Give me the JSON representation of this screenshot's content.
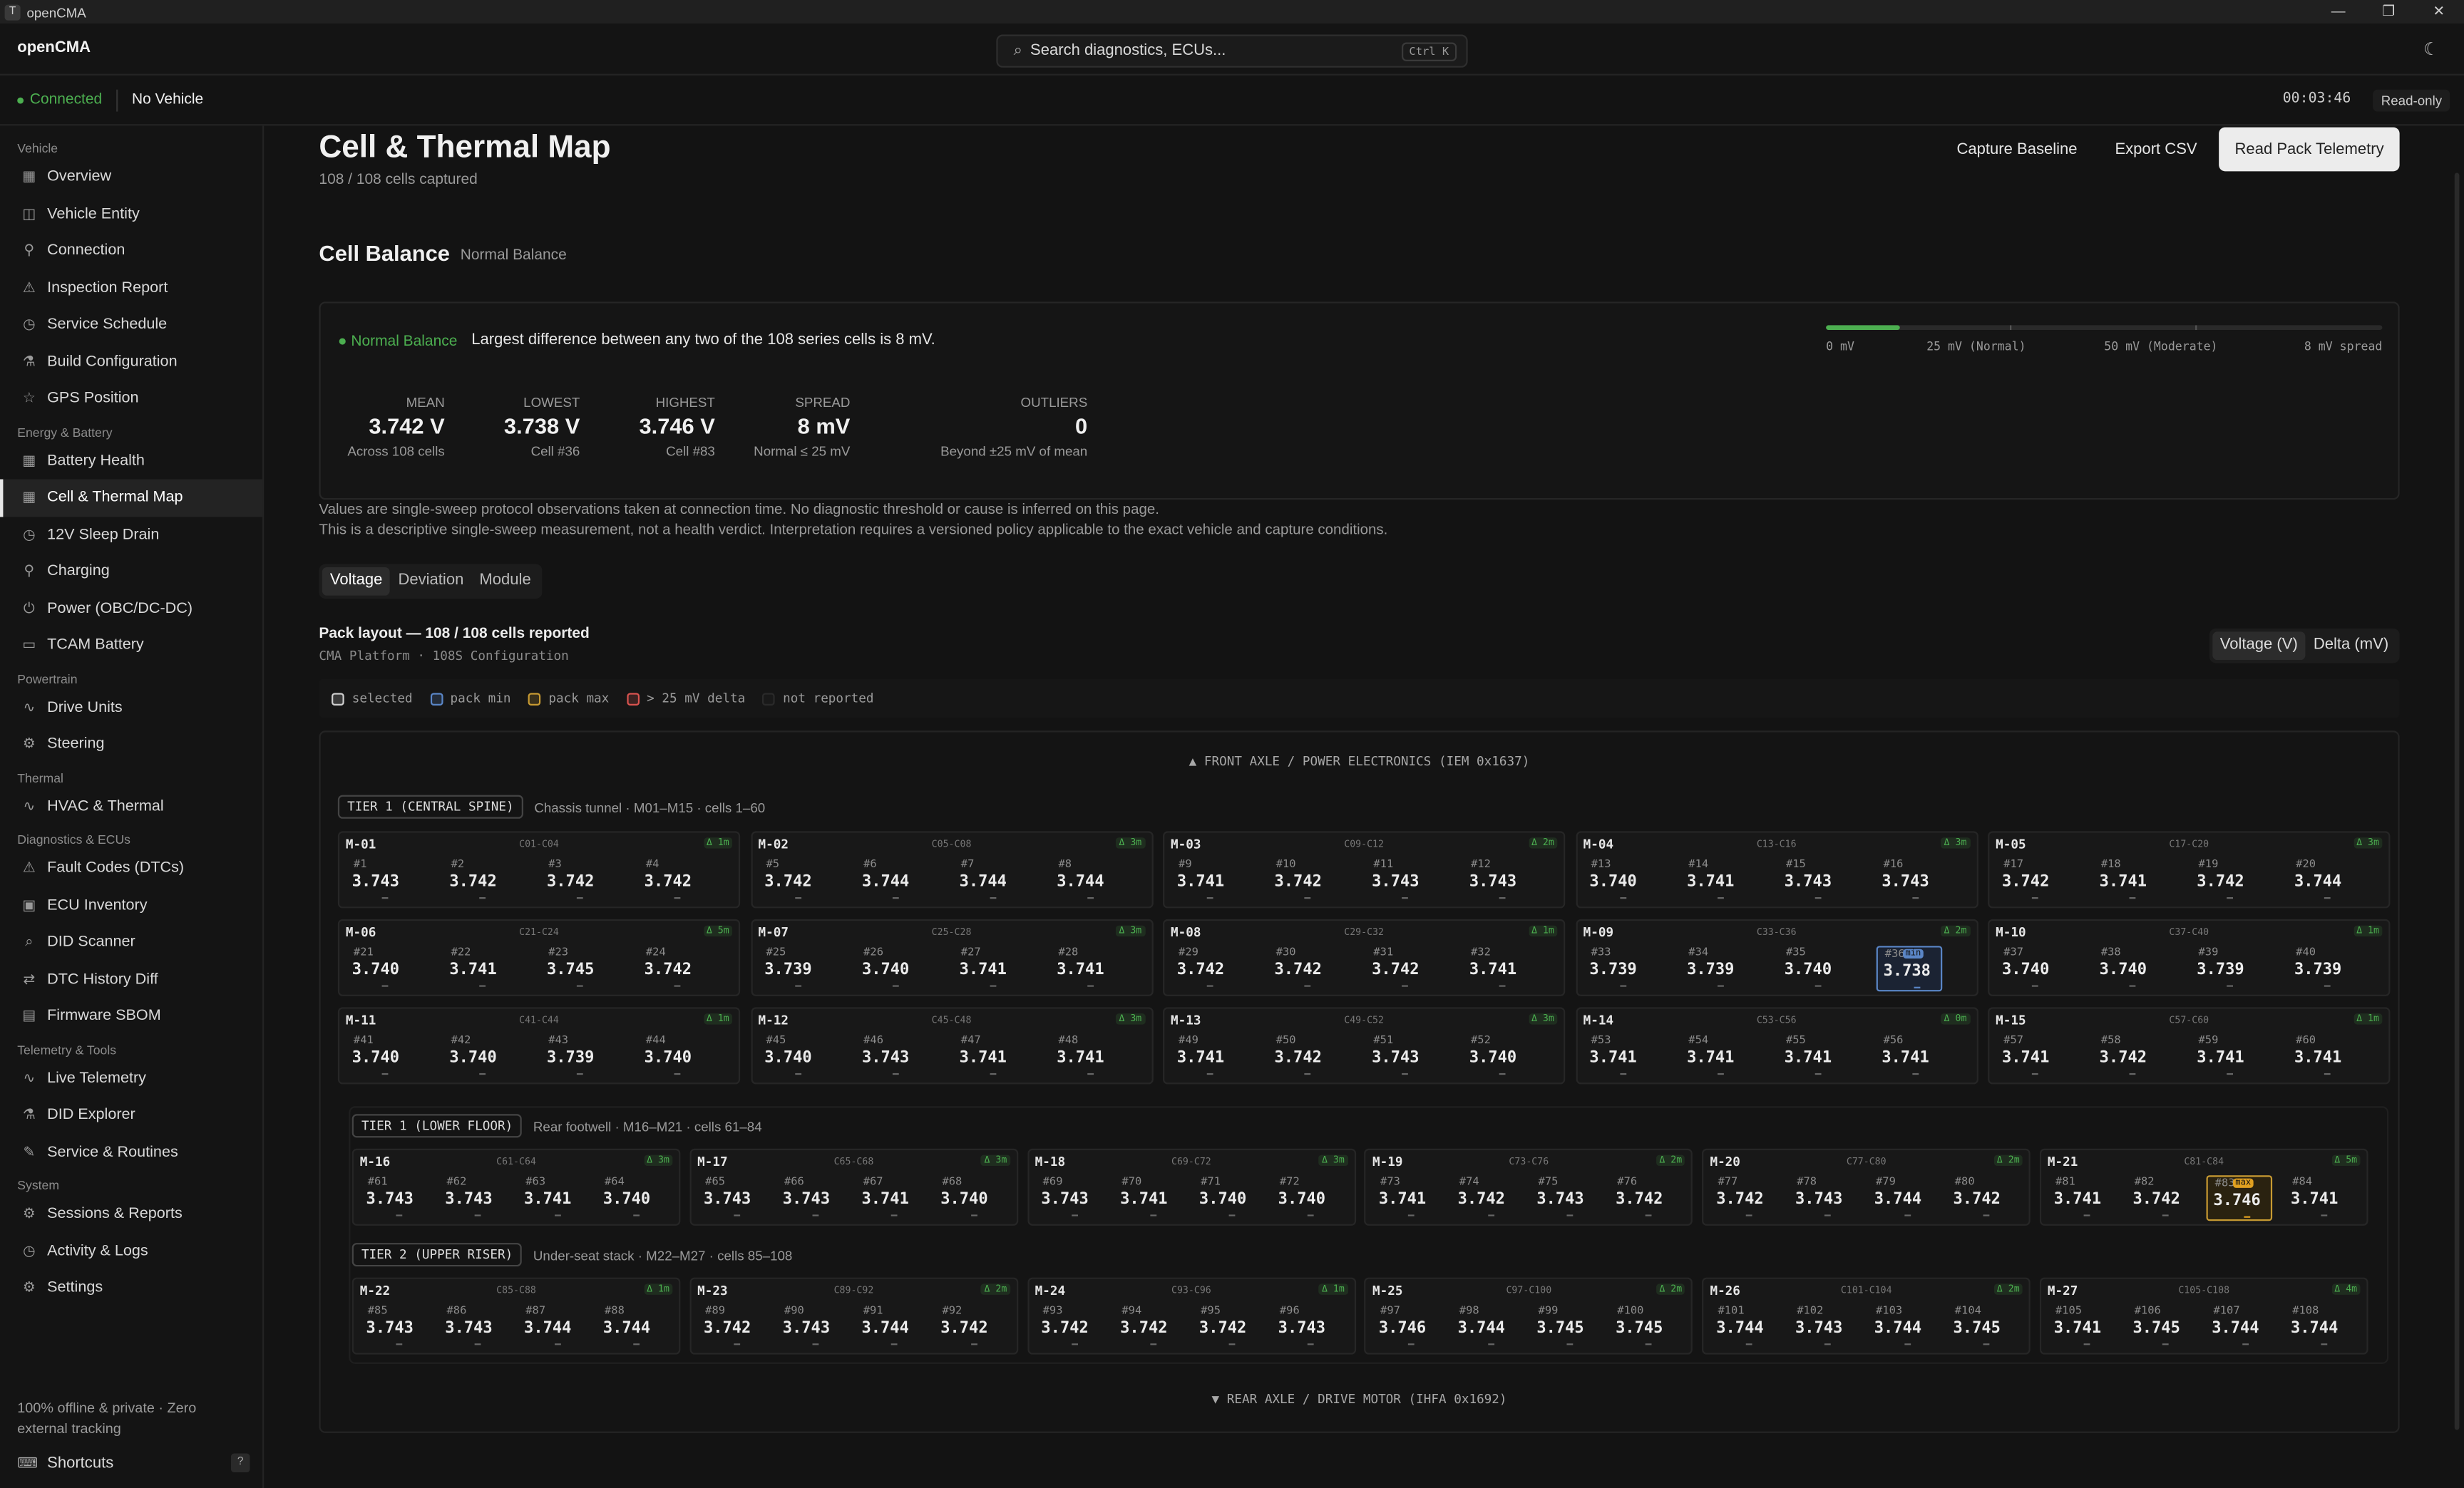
{
  "window": {
    "title": "openCMA",
    "logo": "T",
    "controls": [
      "—",
      "❐",
      "✕"
    ]
  },
  "brand": "openCMA",
  "search": {
    "placeholder": "Search diagnostics, ECUs...",
    "shortcut": "Ctrl K"
  },
  "status": {
    "connection": "Connected",
    "vehicle": "No Vehicle",
    "timer": "00:03:46",
    "mode": "Read-only"
  },
  "sidebar": {
    "sections": [
      {
        "title": "Vehicle",
        "items": [
          {
            "label": "Overview",
            "icon": "grid-icon"
          },
          {
            "label": "Vehicle Entity",
            "icon": "database-icon"
          },
          {
            "label": "Connection",
            "icon": "plug-icon"
          },
          {
            "label": "Inspection Report",
            "icon": "warning-icon"
          },
          {
            "label": "Service Schedule",
            "icon": "clock-icon"
          },
          {
            "label": "Build Configuration",
            "icon": "flask-icon"
          },
          {
            "label": "GPS Position",
            "icon": "star-icon"
          }
        ]
      },
      {
        "title": "Energy & Battery",
        "items": [
          {
            "label": "Battery Health",
            "icon": "grid-icon"
          },
          {
            "label": "Cell & Thermal Map",
            "icon": "grid-icon",
            "active": true
          },
          {
            "label": "12V Sleep Drain",
            "icon": "clock-icon"
          },
          {
            "label": "Charging",
            "icon": "plug-icon"
          },
          {
            "label": "Power (OBC/DC-DC)",
            "icon": "power-icon"
          },
          {
            "label": "TCAM Battery",
            "icon": "battery-icon"
          }
        ]
      },
      {
        "title": "Powertrain",
        "items": [
          {
            "label": "Drive Units",
            "icon": "pulse-icon"
          },
          {
            "label": "Steering",
            "icon": "gear-icon"
          }
        ]
      },
      {
        "title": "Thermal",
        "items": [
          {
            "label": "HVAC & Thermal",
            "icon": "pulse-icon"
          }
        ]
      },
      {
        "title": "Diagnostics & ECUs",
        "items": [
          {
            "label": "Fault Codes (DTCs)",
            "icon": "warning-icon"
          },
          {
            "label": "ECU Inventory",
            "icon": "cpu-icon"
          },
          {
            "label": "DID Scanner",
            "icon": "search-icon"
          },
          {
            "label": "DTC History Diff",
            "icon": "diff-icon"
          },
          {
            "label": "Firmware SBOM",
            "icon": "package-icon"
          }
        ]
      },
      {
        "title": "Telemetry & Tools",
        "items": [
          {
            "label": "Live Telemetry",
            "icon": "pulse-icon"
          },
          {
            "label": "DID Explorer",
            "icon": "flask-icon"
          },
          {
            "label": "Service & Routines",
            "icon": "wrench-icon"
          }
        ]
      },
      {
        "title": "System",
        "items": [
          {
            "label": "Sessions & Reports",
            "icon": "gear-icon"
          },
          {
            "label": "Activity & Logs",
            "icon": "clock-icon"
          },
          {
            "label": "Settings",
            "icon": "gear-icon"
          }
        ]
      }
    ],
    "footer": "100% offline & private · Zero external tracking",
    "shortcuts": "Shortcuts",
    "shortcuts_key": "?"
  },
  "page": {
    "title": "Cell & Thermal Map",
    "subtitle": "108 / 108 cells captured",
    "buttons": {
      "capture": "Capture Baseline",
      "export": "Export CSV",
      "read": "Read Pack Telemetry"
    }
  },
  "balance": {
    "title": "Cell Balance",
    "subtitle": "Normal Balance",
    "status": "Normal Balance",
    "message": "Largest difference between any two of the 108 series cells is 8 mV.",
    "spread_mv": 8,
    "scale_max_mv": 60,
    "scale_labels": [
      "0 mV",
      "25 mV (Normal)",
      "50 mV (Moderate)",
      "8 mV spread"
    ],
    "stats": [
      {
        "label": "MEAN",
        "value": "3.742 V",
        "note": "Across 108 cells"
      },
      {
        "label": "LOWEST",
        "value": "3.738 V",
        "note": "Cell #36"
      },
      {
        "label": "HIGHEST",
        "value": "3.746 V",
        "note": "Cell #83"
      },
      {
        "label": "SPREAD",
        "value": "8 mV",
        "note": "Normal ≤ 25 mV"
      },
      {
        "label": "OUTLIERS",
        "value": "0",
        "note": "Beyond ±25 mV of mean"
      }
    ],
    "notes": [
      "Values are single-sweep protocol observations taken at connection time. No diagnostic threshold or cause is inferred on this page.",
      "This is a descriptive single-sweep measurement, not a health verdict. Interpretation requires a versioned policy applicable to the exact vehicle and capture conditions."
    ]
  },
  "tabs": [
    "Voltage",
    "Deviation",
    "Module"
  ],
  "layout": {
    "title": "Pack layout — 108 / 108 cells reported",
    "subtitle": "CMA Platform · 108S Configuration",
    "toggle": [
      "Voltage (V)",
      "Delta (mV)"
    ],
    "legend": [
      {
        "label": "selected",
        "color": "#cfcfcf"
      },
      {
        "label": "pack min",
        "color": "#5a86c7"
      },
      {
        "label": "pack max",
        "color": "#c79a32"
      },
      {
        "label": "> 25 mV delta",
        "color": "#d9534f"
      },
      {
        "label": "not reported",
        "color": "#2a2a2a"
      }
    ],
    "front": "▲ FRONT AXLE / POWER ELECTRONICS (IEM 0x1637)",
    "rear": "▼ REAR AXLE / DRIVE MOTOR (IHFA 0x1692)",
    "tiers": [
      {
        "badge": "TIER 1 (CENTRAL SPINE)",
        "desc": "Chassis tunnel · M01–M15 · cells 1–60"
      },
      {
        "badge": "TIER 1 (LOWER FLOOR)",
        "desc": "Rear footwell · M16–M21 · cells 61–84"
      },
      {
        "badge": "TIER 2 (UPPER RISER)",
        "desc": "Under-seat stack · M22–M27 · cells 85–108"
      }
    ],
    "modules": [
      {
        "id": "M-01",
        "range": "C01-C04",
        "age": "Δ 1m",
        "cells": [
          3.743,
          3.742,
          3.742,
          3.742
        ]
      },
      {
        "id": "M-02",
        "range": "C05-C08",
        "age": "Δ 3m",
        "cells": [
          3.742,
          3.744,
          3.744,
          3.744
        ]
      },
      {
        "id": "M-03",
        "range": "C09-C12",
        "age": "Δ 2m",
        "cells": [
          3.741,
          3.742,
          3.743,
          3.743
        ]
      },
      {
        "id": "M-04",
        "range": "C13-C16",
        "age": "Δ 3m",
        "cells": [
          3.74,
          3.741,
          3.743,
          3.743
        ]
      },
      {
        "id": "M-05",
        "range": "C17-C20",
        "age": "Δ 3m",
        "cells": [
          3.742,
          3.741,
          3.742,
          3.744
        ]
      },
      {
        "id": "M-06",
        "range": "C21-C24",
        "age": "Δ 5m",
        "cells": [
          3.74,
          3.741,
          3.745,
          3.742
        ]
      },
      {
        "id": "M-07",
        "range": "C25-C28",
        "age": "Δ 3m",
        "cells": [
          3.739,
          3.74,
          3.741,
          3.741
        ]
      },
      {
        "id": "M-08",
        "range": "C29-C32",
        "age": "Δ 1m",
        "cells": [
          3.742,
          3.742,
          3.742,
          3.741
        ]
      },
      {
        "id": "M-09",
        "range": "C33-C36",
        "age": "Δ 2m",
        "cells": [
          3.739,
          3.739,
          3.74,
          3.738
        ]
      },
      {
        "id": "M-10",
        "range": "C37-C40",
        "age": "Δ 1m",
        "cells": [
          3.74,
          3.74,
          3.739,
          3.739
        ]
      },
      {
        "id": "M-11",
        "range": "C41-C44",
        "age": "Δ 1m",
        "cells": [
          3.74,
          3.74,
          3.739,
          3.74
        ]
      },
      {
        "id": "M-12",
        "range": "C45-C48",
        "age": "Δ 3m",
        "cells": [
          3.74,
          3.743,
          3.741,
          3.741
        ]
      },
      {
        "id": "M-13",
        "range": "C49-C52",
        "age": "Δ 3m",
        "cells": [
          3.741,
          3.742,
          3.743,
          3.74
        ]
      },
      {
        "id": "M-14",
        "range": "C53-C56",
        "age": "Δ 0m",
        "cells": [
          3.741,
          3.741,
          3.741,
          3.741
        ]
      },
      {
        "id": "M-15",
        "range": "C57-C60",
        "age": "Δ 1m",
        "cells": [
          3.741,
          3.742,
          3.741,
          3.741
        ]
      },
      {
        "id": "M-16",
        "range": "C61-C64",
        "age": "Δ 3m",
        "cells": [
          3.743,
          3.743,
          3.741,
          3.74
        ]
      },
      {
        "id": "M-17",
        "range": "C65-C68",
        "age": "Δ 3m",
        "cells": [
          3.743,
          3.743,
          3.741,
          3.74
        ]
      },
      {
        "id": "M-18",
        "range": "C69-C72",
        "age": "Δ 3m",
        "cells": [
          3.743,
          3.741,
          3.74,
          3.74
        ]
      },
      {
        "id": "M-19",
        "range": "C73-C76",
        "age": "Δ 2m",
        "cells": [
          3.741,
          3.742,
          3.743,
          3.742
        ]
      },
      {
        "id": "M-20",
        "range": "C77-C80",
        "age": "Δ 2m",
        "cells": [
          3.742,
          3.743,
          3.744,
          3.742
        ]
      },
      {
        "id": "M-21",
        "range": "C81-C84",
        "age": "Δ 5m",
        "cells": [
          3.741,
          3.742,
          3.746,
          3.741
        ]
      },
      {
        "id": "M-22",
        "range": "C85-C88",
        "age": "Δ 1m",
        "cells": [
          3.743,
          3.743,
          3.744,
          3.744
        ]
      },
      {
        "id": "M-23",
        "range": "C89-C92",
        "age": "Δ 2m",
        "cells": [
          3.742,
          3.743,
          3.744,
          3.742
        ]
      },
      {
        "id": "M-24",
        "range": "C93-C96",
        "age": "Δ 1m",
        "cells": [
          3.742,
          3.742,
          3.742,
          3.743
        ]
      },
      {
        "id": "M-25",
        "range": "C97-C100",
        "age": "Δ 2m",
        "cells": [
          3.746,
          3.744,
          3.745,
          3.745
        ]
      },
      {
        "id": "M-26",
        "range": "C101-C104",
        "age": "Δ 2m",
        "cells": [
          3.744,
          3.743,
          3.744,
          3.745
        ]
      },
      {
        "id": "M-27",
        "range": "C105-C108",
        "age": "Δ 4m",
        "cells": [
          3.741,
          3.745,
          3.744,
          3.744
        ]
      }
    ],
    "min_cell": 36,
    "min_tag": "min",
    "max_cell": 83,
    "max_tag": "max"
  }
}
